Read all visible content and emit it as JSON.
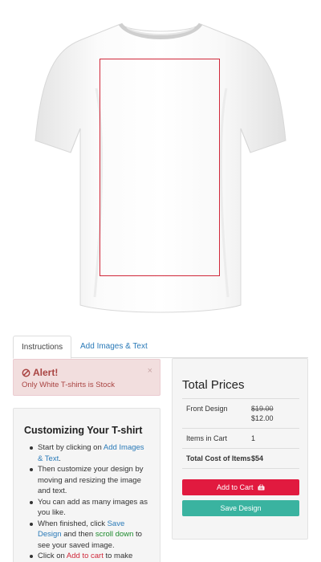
{
  "tabs": [
    {
      "label": "Instructions",
      "active": true
    },
    {
      "label": "Add Images & Text",
      "active": false
    }
  ],
  "alert": {
    "title": "Alert!",
    "message": "Only White T-shirts is Stock",
    "close": "×"
  },
  "instructions": {
    "title": "Customizing Your T-shirt",
    "steps": [
      {
        "before": "Start by clicking on ",
        "link": "Add Images & Text",
        "after": "."
      },
      {
        "text": "Then customize your design by moving and resizing the image and text."
      },
      {
        "text": "You can add as many images as you like."
      },
      {
        "before": "When finished, click ",
        "link": "Save Design",
        "middle": " and then ",
        "link2": "scroll down",
        "after": " to see your saved image."
      },
      {
        "before": "Click on ",
        "link": "Add to cart",
        "after": " to make"
      }
    ]
  },
  "prices": {
    "title": "Total Prices",
    "rows": [
      {
        "label": "Front Design",
        "old_price": "$19.00",
        "price": "$12.00"
      },
      {
        "label": "Items in Cart",
        "value": "1"
      },
      {
        "label": "Total Cost of Items",
        "value": "$54"
      }
    ],
    "add_to_cart": "Add to Cart",
    "save_design": "Save Design"
  },
  "colors": {
    "accent_red": "#e11a3f",
    "accent_teal": "#3ab3a0",
    "link_blue": "#2a7ab8",
    "alert_bg": "#f2dede"
  },
  "icons": {
    "alert": "ban-icon",
    "cart": "shopping-basket-icon"
  }
}
